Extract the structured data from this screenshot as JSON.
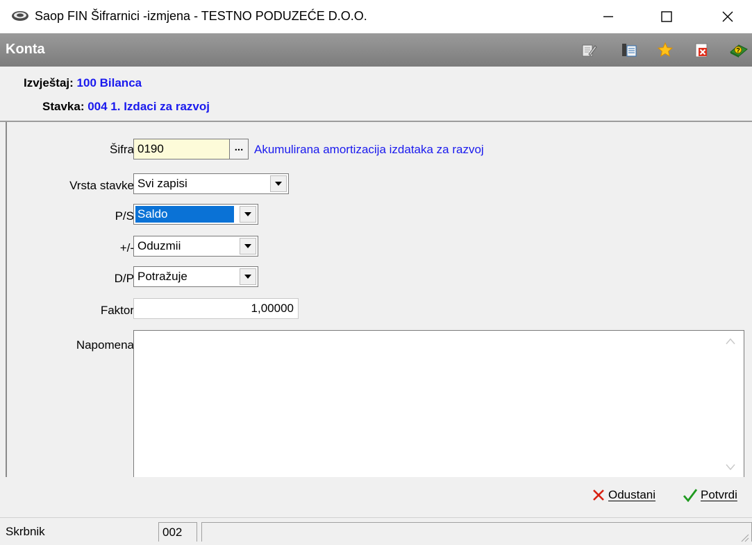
{
  "window": {
    "title": "Saop FIN Šifrarnici -izmjena  - TESTNO PODUZEĆE D.O.O.",
    "minimize_icon": "minimize-icon",
    "maximize_icon": "maximize-icon",
    "close_icon": "close-icon"
  },
  "header": {
    "title": "Konta",
    "toolbar_icons": [
      "edit-icon",
      "columns-icon",
      "star-icon",
      "delete-icon",
      "help-icon"
    ]
  },
  "info": {
    "report_label": "Izvještaj:",
    "report_value": "100 Bilanca",
    "item_label": "Stavka:",
    "item_value": "004 1. Izdaci za razvoj"
  },
  "form": {
    "sifra_label": "Šifra",
    "sifra_value": "0190",
    "sifra_browse": "...",
    "sifra_description": "Akumulirana amortizacija izdataka za razvoj",
    "vrsta_label": "Vrsta stavke",
    "vrsta_value": "Svi zapisi",
    "ps_label": "P/S",
    "ps_value": "Saldo",
    "plusminus_label": "+/-",
    "plusminus_value": "Oduzmii",
    "dp_label": "D/P",
    "dp_value": "Potražuje",
    "faktor_label": "Faktor",
    "faktor_value": "1,00000",
    "napomena_label": "Napomena",
    "napomena_value": ""
  },
  "actions": {
    "cancel_label": "Odustani",
    "confirm_label": "Potvrdi"
  },
  "status": {
    "owner_label": "Skrbnik",
    "owner_value": "002"
  },
  "colors": {
    "accent_blue": "#1a1aee",
    "header_gray": "#8a8a8a",
    "selection": "#0a72d6",
    "sifra_bg": "#fdfbd9"
  }
}
